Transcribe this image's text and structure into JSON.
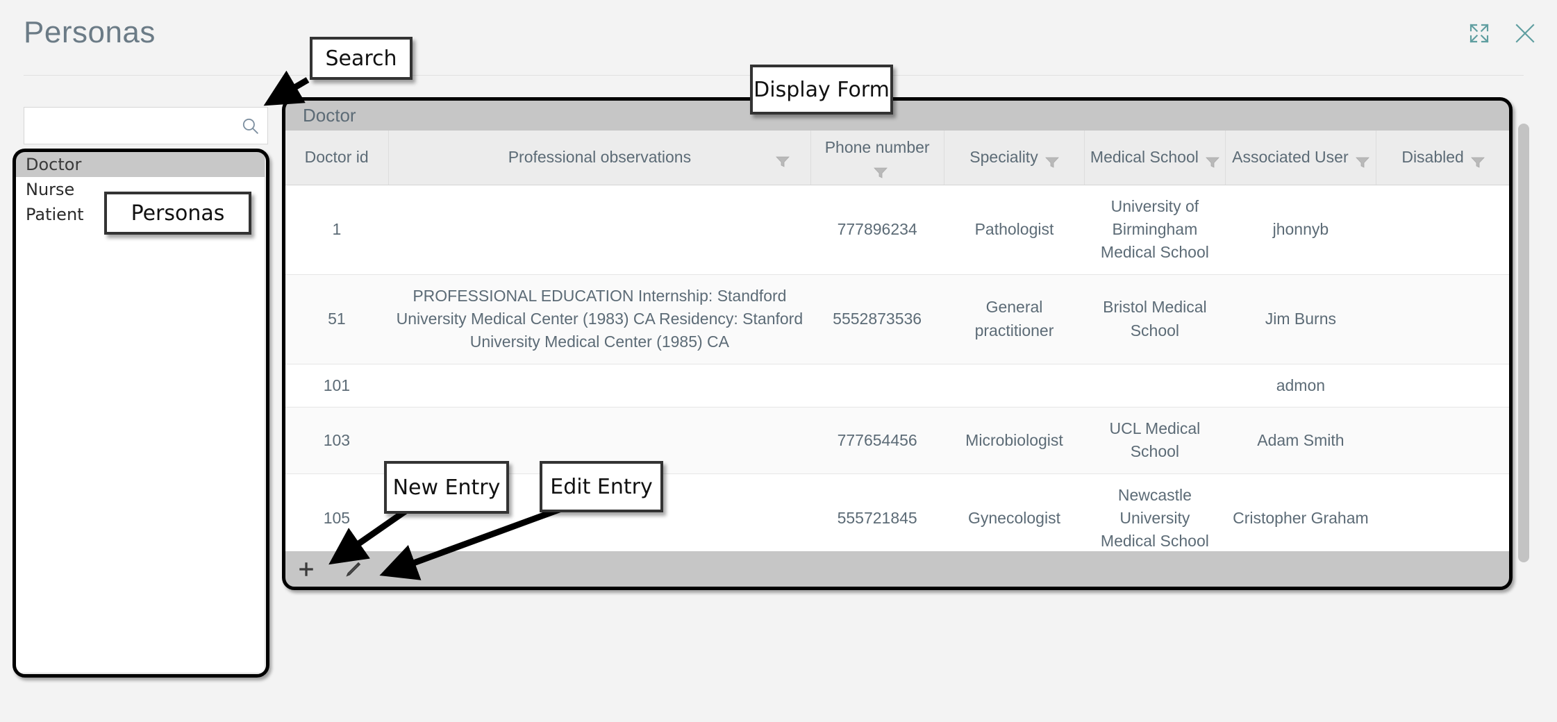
{
  "window": {
    "title": "Personas",
    "controls": [
      {
        "name": "expand-icon",
        "label": "Expand"
      },
      {
        "name": "close-icon",
        "label": "Close"
      }
    ],
    "accent_color": "#5f9ea0",
    "title_color": "#6b7b86"
  },
  "search": {
    "value": "",
    "placeholder": "",
    "icon": "search-icon"
  },
  "entity_list": {
    "items": [
      {
        "label": "Doctor",
        "selected": true
      },
      {
        "label": "Nurse",
        "selected": false
      },
      {
        "label": "Patient",
        "selected": false
      }
    ]
  },
  "grid": {
    "caption": "Doctor",
    "columns": [
      {
        "key": "doctor_id",
        "label": "Doctor id",
        "filter": false
      },
      {
        "key": "observations",
        "label": "Professional observations",
        "filter": true
      },
      {
        "key": "phone",
        "label": "Phone number",
        "filter": true
      },
      {
        "key": "speciality",
        "label": "Speciality",
        "filter": true
      },
      {
        "key": "medical_school",
        "label": "Medical School",
        "filter": true
      },
      {
        "key": "associated_user",
        "label": "Associated User",
        "filter": true
      },
      {
        "key": "disabled",
        "label": "Disabled",
        "filter": true
      }
    ],
    "rows": [
      {
        "doctor_id": "1",
        "observations": "",
        "phone": "777896234",
        "speciality": "Pathologist",
        "medical_school": "University of Birmingham Medical School",
        "associated_user": "jhonnyb",
        "disabled": ""
      },
      {
        "doctor_id": "51",
        "observations": "PROFESSIONAL EDUCATION Internship: Standford University Medical Center (1983) CA Residency: Stanford University Medical Center (1985) CA",
        "phone": "5552873536",
        "speciality": "General practitioner",
        "medical_school": "Bristol Medical School",
        "associated_user": "Jim Burns",
        "disabled": ""
      },
      {
        "doctor_id": "101",
        "observations": "",
        "phone": "",
        "speciality": "",
        "medical_school": "",
        "associated_user": "admon",
        "disabled": ""
      },
      {
        "doctor_id": "103",
        "observations": "",
        "phone": "777654456",
        "speciality": "Microbiologist",
        "medical_school": "UCL Medical School",
        "associated_user": "Adam Smith",
        "disabled": ""
      },
      {
        "doctor_id": "105",
        "observations": "",
        "phone": "555721845",
        "speciality": "Gynecologist",
        "medical_school": "Newcastle University Medical School",
        "associated_user": "Cristopher Graham",
        "disabled": ""
      }
    ],
    "toolbar": [
      {
        "name": "new-entry-button",
        "icon": "plus-icon"
      },
      {
        "name": "edit-entry-button",
        "icon": "pencil-icon"
      }
    ]
  },
  "annotations": [
    {
      "id": "search",
      "label": "Search"
    },
    {
      "id": "display_form",
      "label": "Display Form"
    },
    {
      "id": "personas",
      "label": "Personas"
    },
    {
      "id": "new_entry",
      "label": "New Entry"
    },
    {
      "id": "edit_entry",
      "label": "Edit Entry"
    }
  ]
}
